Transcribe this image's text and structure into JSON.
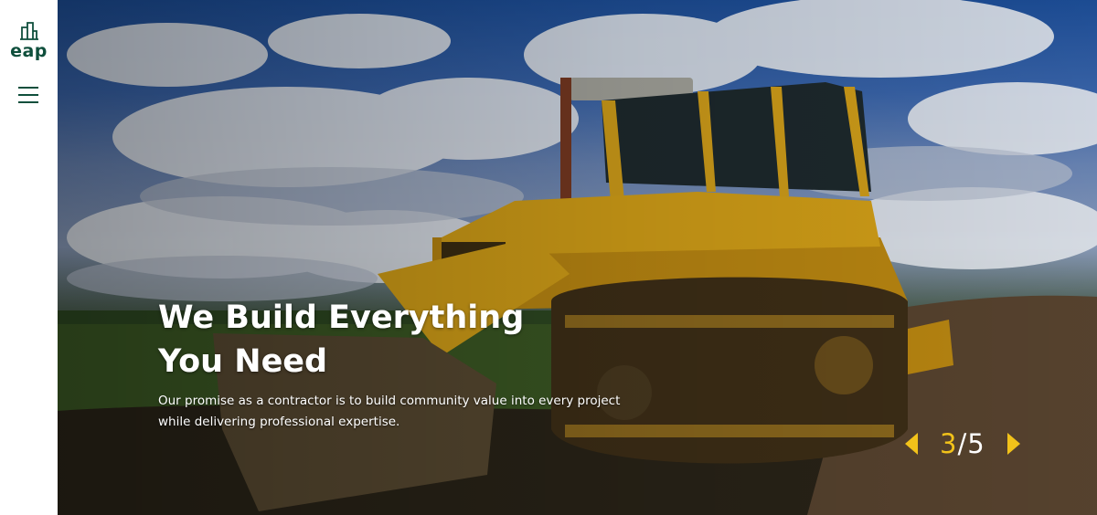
{
  "brand": {
    "logo_text": "eap",
    "logo_icon": "building-icon",
    "menu_icon": "hamburger-menu-icon",
    "color": "#0f4f3c"
  },
  "hero": {
    "headline": "We Build Everything You Need",
    "subtext": "Our promise as a contractor is to build community value into every project while delivering professional expertise.",
    "image_subject": "yellow bulldozer under a cloudy sky"
  },
  "slider": {
    "current": "3",
    "separator": "/",
    "total": "5",
    "prev_icon": "arrow-left-icon",
    "next_icon": "arrow-right-icon",
    "accent_color": "#f2c21a"
  }
}
